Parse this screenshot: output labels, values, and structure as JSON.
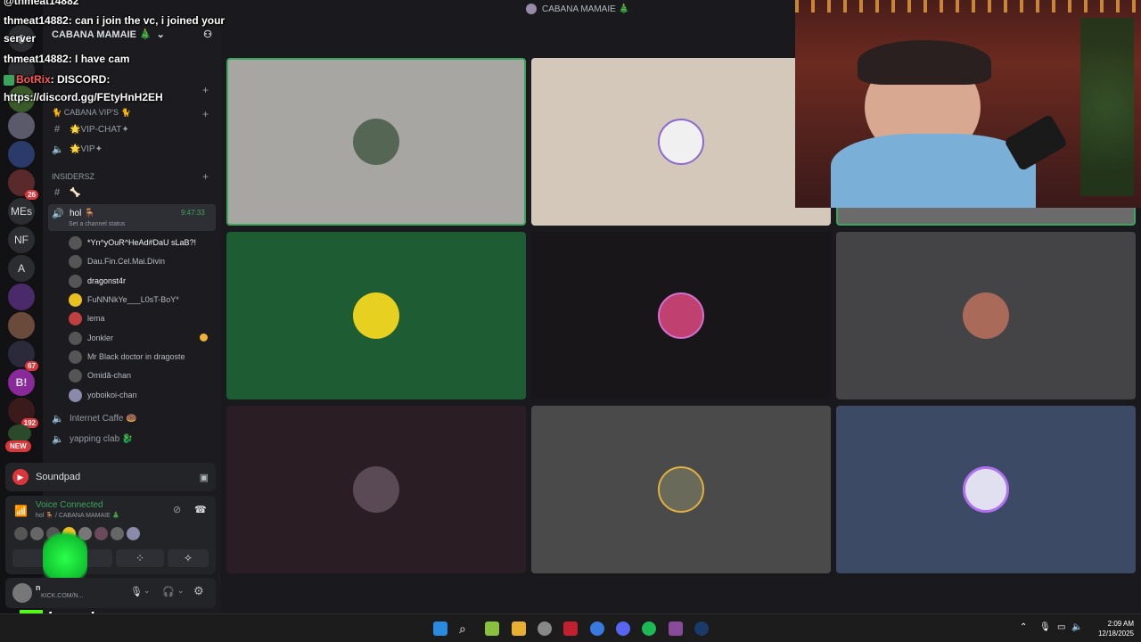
{
  "top_title": "CABANA MAMAIE 🎄",
  "server": {
    "name": "CABANA MAMAIE 🎄",
    "badges": [
      "26",
      "67",
      "192"
    ],
    "initials": [
      "MEs",
      "NF",
      "A"
    ],
    "new_label": "NEW"
  },
  "channels": {
    "cat_vip": "🐈 CABANA VIP's 🐈",
    "vip_chat": "🌟VIP-CHAT✦",
    "vip_voice": "🌟VIP✦",
    "cat_insiders": "INSIDERSz",
    "insiders_text": "🦴",
    "active_voice": "hol 🪑",
    "active_time": "9:47:33",
    "channel_status": "Set a channel status",
    "voice_users": [
      "*Yn^yOuR^HeAd#DaU sLaB?!",
      "Dau.Fin.Cel.Mai.Divin",
      "dragonst4r",
      "FuNNNkYe___L0sT-BoY*",
      "lema",
      "Jonkler",
      "Mr Black doctor in dragoste",
      "Omidă-chan",
      "yoboikoi-chan"
    ],
    "internet_caffe": "Internet Caffe 🍩",
    "yapping_clab": "yapping clab 🐉"
  },
  "soundpad": {
    "label": "Soundpad"
  },
  "voice_status": {
    "title": "Voice Connected",
    "subtitle": "hol 🪑 / CABANA MAMAIE 🎄"
  },
  "user_panel": {
    "name": "n",
    "status": "KICK.COM/N..."
  },
  "chat": [
    {
      "user": "@thmeat14882",
      "text": ""
    },
    {
      "user": "thmeat14882",
      "text": ": can i join the vc, i joined your"
    },
    {
      "user": "",
      "text": "server"
    },
    {
      "user": "thmeat14882",
      "text": ": I have cam"
    },
    {
      "user": "BotRix",
      "text": ": DISCORD:"
    },
    {
      "user": "",
      "text": "https://discord.gg/FEtyHnH2EH"
    }
  ],
  "streamer": {
    "logo_letter": "K",
    "name": "lavashy"
  },
  "taskbar": {
    "time": "2:09 AM",
    "date": "12/18/2025"
  },
  "tiles": [
    {
      "bg": "#a8a6a3",
      "border": "#3ba55d"
    },
    {
      "bg": "#d4c8bb",
      "border": ""
    },
    {
      "bg": "#6b6b6b",
      "border": "#3ba55d"
    },
    {
      "bg": "#1e5c34",
      "border": ""
    },
    {
      "bg": "#181618",
      "border": ""
    },
    {
      "bg": "#444446",
      "border": ""
    },
    {
      "bg": "#2a1e24",
      "border": ""
    },
    {
      "bg": "#4a4a4a",
      "border": ""
    },
    {
      "bg": "#3c4a66",
      "border": ""
    }
  ]
}
